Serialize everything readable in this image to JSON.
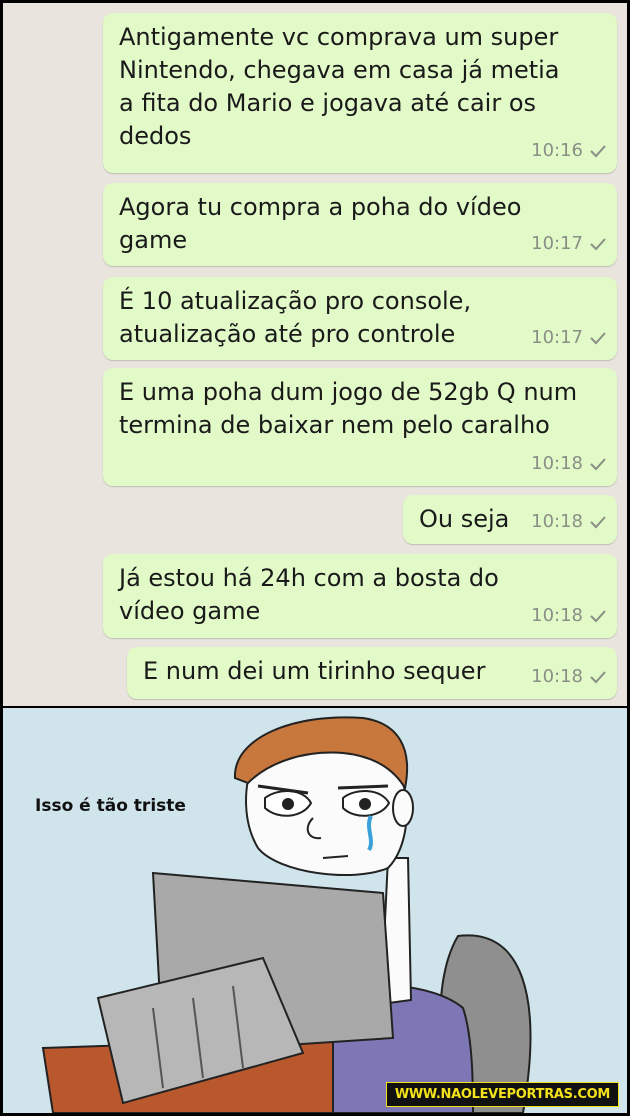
{
  "chat": {
    "messages": [
      {
        "text": "Antigamente vc comprava um super\nNintendo, chegava em casa já metia\na fita do Mario e jogava até cair os\ndedos",
        "time": "10:16"
      },
      {
        "text": "Agora tu compra a poha do vídeo\ngame",
        "time": "10:17"
      },
      {
        "text": "É 10 atualização pro console,\natualização até pro controle",
        "time": "10:17"
      },
      {
        "text": "E uma poha dum jogo de 52gb Q num\ntermina de baixar nem pelo caralho",
        "time": "10:18"
      },
      {
        "text": "Ou seja",
        "time": "10:18"
      },
      {
        "text": "Já estou há 24h com a bosta do\nvídeo game",
        "time": "10:18"
      },
      {
        "text": "E num dei um tirinho sequer",
        "time": "10:18"
      }
    ],
    "status_icon": "single-check-icon",
    "colors": {
      "bubble": "#e2f9c8",
      "background": "#e9e4dd",
      "time": "#8a8f86"
    }
  },
  "comic": {
    "caption": "Isso é tão triste",
    "watermark": "WWW.NAOLEVEPORTRAS.COM",
    "colors": {
      "sky": "#cfe4eb",
      "monitor": "#a9a9a9",
      "shirt": "#7d77b5",
      "hair": "#c9783d",
      "desk": "#b8582c"
    }
  }
}
